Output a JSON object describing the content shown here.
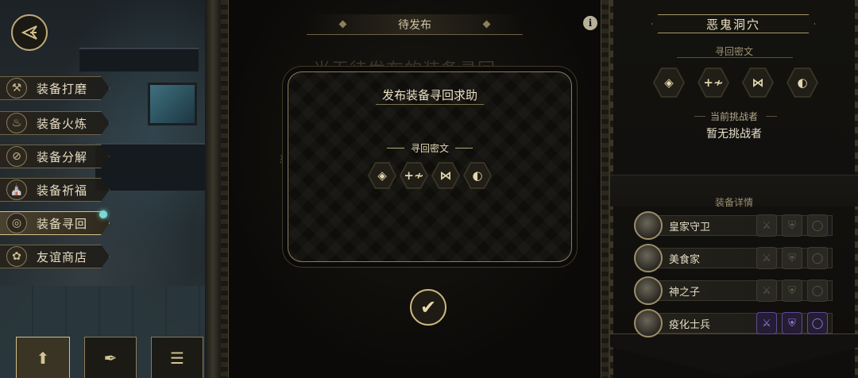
{
  "nav": {
    "items": [
      {
        "label": "装备打磨",
        "icon": "hammer-icon",
        "glyph": "⚒"
      },
      {
        "label": "装备火炼",
        "icon": "flame-icon",
        "glyph": "♨"
      },
      {
        "label": "装备分解",
        "icon": "decompose-icon",
        "glyph": "⊘"
      },
      {
        "label": "装备祈福",
        "icon": "pray-icon",
        "glyph": "⛪"
      },
      {
        "label": "装备寻回",
        "icon": "retrieve-icon",
        "glyph": "◎"
      },
      {
        "label": "友谊商店",
        "icon": "fox-icon",
        "glyph": "✿"
      }
    ],
    "active_index": 4
  },
  "bottom_tabs": [
    {
      "icon": "upload-icon",
      "glyph": "⬆"
    },
    {
      "icon": "feather-icon",
      "glyph": "✒"
    },
    {
      "icon": "list-icon",
      "glyph": "☰"
    }
  ],
  "center": {
    "header": "待发布",
    "background_text": "当无待发布的装备寻回",
    "partial_char": "恶",
    "info_glyph": "i"
  },
  "dialog": {
    "title": "发布装备寻回求助",
    "cipher_label": "寻回密文",
    "cipher_icons": [
      {
        "icon": "spiral-rune-icon",
        "glyph": "◈"
      },
      {
        "icon": "plus-wave-rune-icon",
        "glyph": "+≁"
      },
      {
        "icon": "cross-rune-icon",
        "glyph": "⋈"
      },
      {
        "icon": "split-rune-icon",
        "glyph": "◐"
      }
    ],
    "confirm_glyph": "✔"
  },
  "right": {
    "dungeon_title": "恶鬼洞穴",
    "cipher_label": "寻回密文",
    "challenger_label": "当前挑战者",
    "challenger_value": "暂无挑战者",
    "equipment_label": "装备详情",
    "heroes": [
      {
        "name": "皇家守卫",
        "purple": false
      },
      {
        "name": "美食家",
        "purple": false
      },
      {
        "name": "神之子",
        "purple": false
      },
      {
        "name": "疫化士兵",
        "purple": true
      }
    ],
    "slot_icons": [
      {
        "icon": "weapon-slot-icon",
        "glyph": "⚔"
      },
      {
        "icon": "armor-slot-icon",
        "glyph": "⛨"
      },
      {
        "icon": "trinket-slot-icon",
        "glyph": "◯"
      }
    ]
  },
  "colors": {
    "gold": "#cbb77e",
    "purple": "#9d7fe6",
    "accent_cyan": "#7ad9d3"
  }
}
